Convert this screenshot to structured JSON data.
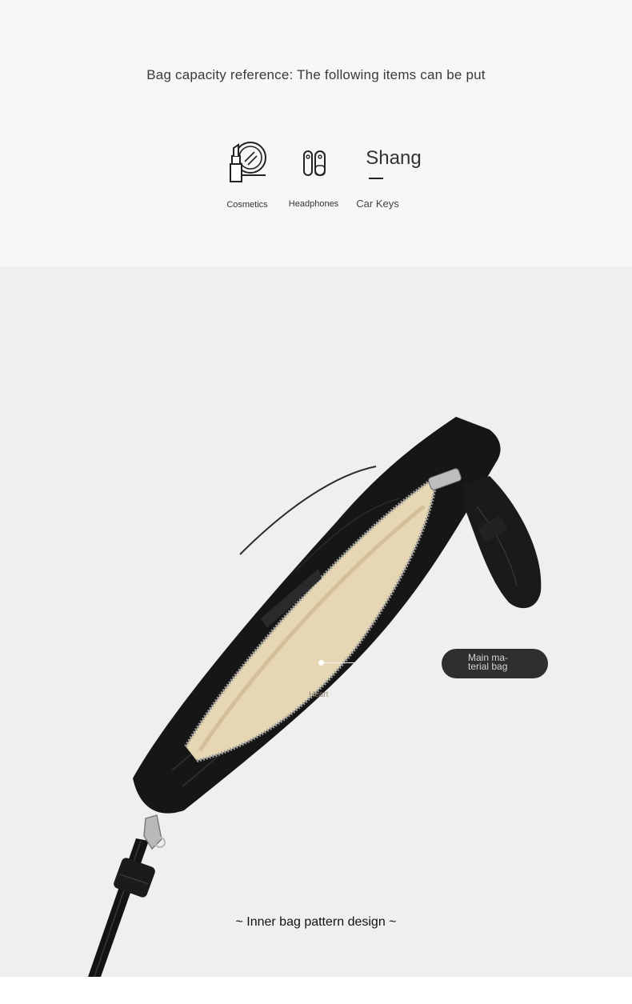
{
  "header": {
    "capacity_text": "Bag capacity reference: The following items can be put"
  },
  "items": [
    {
      "icon": "lipstick-mirror-icon",
      "label": "Cosmetics"
    },
    {
      "icon": "earbuds-icon",
      "label": "Headphones"
    },
    {
      "brand_text": "Shang",
      "label": "Car Keys"
    }
  ],
  "photo": {
    "callout_label": "Main ma- terial bag",
    "inner_tag": "Heart",
    "caption": "~ Inner bag pattern design ~"
  },
  "colors": {
    "top_background": "#f7f7f7",
    "photo_background": "#efefef",
    "bag_leather": "#161616",
    "bag_lining": "#e6d6b4",
    "callout_pill": "#2f2f2f"
  }
}
